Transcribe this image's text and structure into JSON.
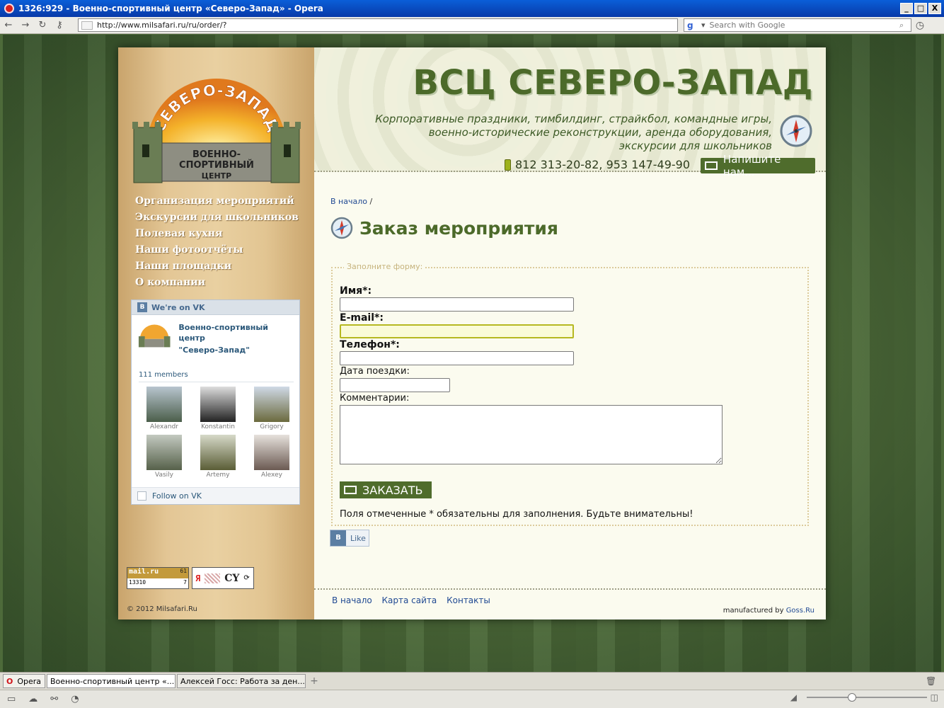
{
  "window": {
    "title": "1326:929 - Военно-спортивный центр «Северо-Запад» - Opera",
    "minimize": "_",
    "maximize": "□",
    "close": "X"
  },
  "toolbar": {
    "url": "http://www.milsafari.ru/ru/order/?",
    "search_placeholder": "Search with Google"
  },
  "site": {
    "logo_text": {
      "arc": "СЕВЕРО-ЗАПАД",
      "line1": "ВОЕННО-",
      "line2": "СПОРТИВНЫЙ",
      "line3": "ЦЕНТР"
    },
    "title": "ВСЦ СЕВЕРО-ЗАПАД",
    "tagline": [
      "Корпоративные праздники, тимбилдинг, страйкбол, командные игры,",
      "военно-исторические реконструкции, аренда оборудования,",
      "экскурсии для школьников"
    ],
    "phones": "812 313-20-82, 953 147-49-90",
    "write_us": "Напишите нам...",
    "menu": [
      "Организация мероприятий",
      "Экскурсии для школьников",
      "Полевая кухня",
      "Наши фотоотчёты",
      "Наши площадки",
      "О компании"
    ]
  },
  "vk_widget": {
    "header": "We're on VK",
    "group_name_1": "Военно-спортивный центр",
    "group_name_2": "\"Северо-Запад\"",
    "members": "111 members",
    "people": [
      "Alexandr",
      "Konstantin",
      "Grigory",
      "Vasily",
      "Artemy",
      "Alexey"
    ],
    "follow": "Follow on VK"
  },
  "counters": {
    "mail_label": "mail.ru",
    "mail_top_num": "61",
    "mail_visits": "13310",
    "mail_small": "7",
    "ya_label": "Я",
    "cy_label": "CY"
  },
  "copyright": "© 2012 Milsafari.Ru",
  "breadcrumb": {
    "home": "В начало",
    "sep": " /"
  },
  "page_title": "Заказ мероприятия",
  "form": {
    "legend": "Заполните форму:",
    "name_label": "Имя*:",
    "email_label": "E-mail*:",
    "phone_label": "Телефон*:",
    "date_label": "Дата поездки:",
    "comments_label": "Комментарии:",
    "submit": "ЗАКАЗАТЬ",
    "note": "Поля отмеченные * обязательны для заполнения. Будьте внимательны!"
  },
  "like": "Like",
  "footer": {
    "links": [
      "В начало",
      "Карта сайта",
      "Контакты"
    ],
    "manufactured": "manufactured by",
    "manufactured_link": "Goss.Ru"
  },
  "tabs": {
    "opera": "Opera",
    "items": [
      {
        "label": "Военно-спортивный центр «...",
        "active": true
      },
      {
        "label": "Алексей Госс: Работа за ден...",
        "active": false
      }
    ]
  }
}
